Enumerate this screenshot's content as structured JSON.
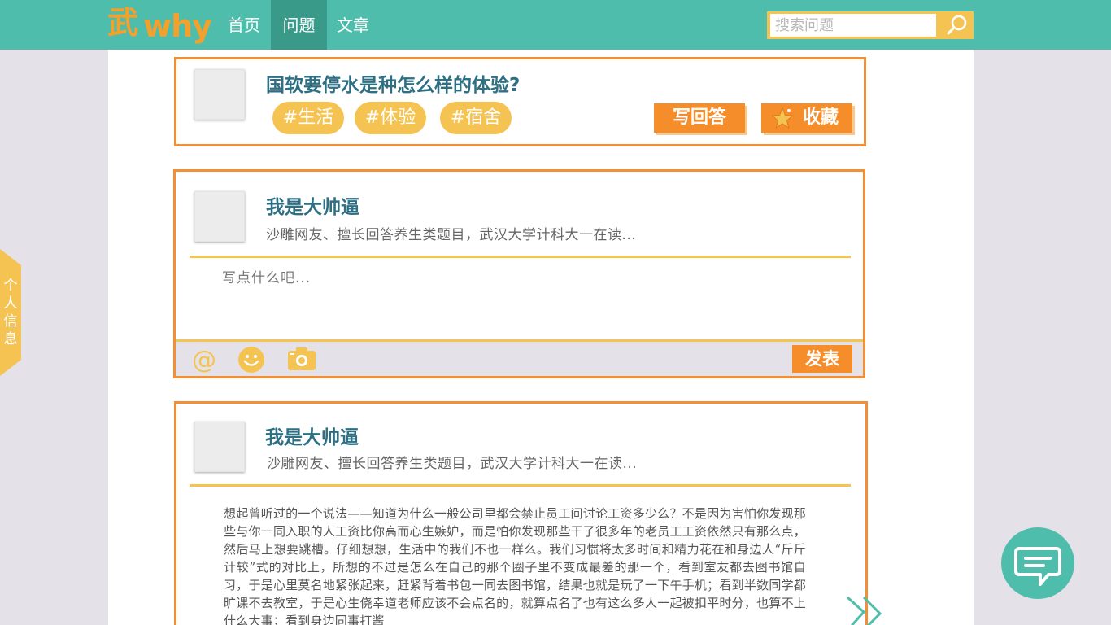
{
  "nav": {
    "logo_mark": "武",
    "logo_text": "why",
    "items": [
      {
        "label": "首页"
      },
      {
        "label": "问题"
      },
      {
        "label": "文章"
      }
    ],
    "search_placeholder": "搜索问题"
  },
  "question": {
    "title": "国软要停水是种怎么样的体验?",
    "tags": [
      "#生活",
      "#体验",
      "#宿舍"
    ],
    "answer_button": "写回答",
    "favorite_button": "收藏"
  },
  "compose": {
    "user_name": "我是大帅逼",
    "user_bio": "沙雕网友、擅长回答养生类题目，武汉大学计科大一在读...",
    "placeholder": "写点什么吧...",
    "publish_button": "发表",
    "tools": [
      "at-icon",
      "smiley-icon",
      "camera-icon"
    ]
  },
  "answer": {
    "user_name": "我是大帅逼",
    "user_bio": "沙雕网友、擅长回答养生类题目，武汉大学计科大一在读...",
    "body": "想起曾听过的一个说法——知道为什么一般公司里都会禁止员工间讨论工资多少么？不是因为害怕你发现那些与你一同入职的人工资比你高而心生嫉妒，而是怕你发现那些干了很多年的老员工工资依然只有那么点，然后马上想要跳槽。仔细想想，生活中的我们不也一样么。我们习惯将太多时间和精力花在和身边人“斤斤计较”式的对比上，所想的不过是怎么在自己的那个圈子里不变成最差的那一个，看到室友都去图书馆自习，于是心里莫名地紧张起来，赶紧背着书包一同去图书馆，结果也就是玩了一下午手机；看到半数同学都旷课不去教室，于是心生侥幸道老师应该不会点名的，就算点名了也有这么多人一起被扣平时分，也算不上什么大事；看到身边同事打酱"
  },
  "side_tab": "个人信息",
  "colors": {
    "teal": "#4fbdab",
    "orange": "#f58e2a",
    "yellow": "#f5c352",
    "title_blue": "#2e6f84"
  }
}
